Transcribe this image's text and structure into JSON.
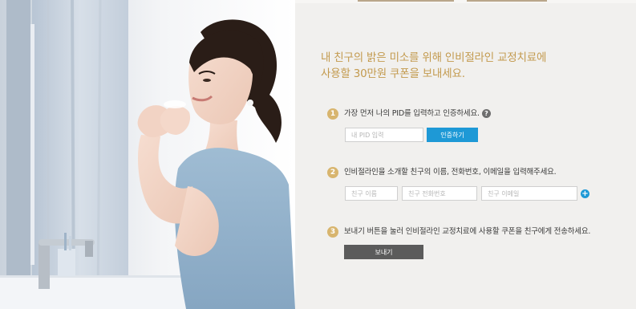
{
  "headline": {
    "line1": "내 친구의 밝은 미소를 위해 인비절라인 교정치료에",
    "line2": "사용할 30만원 쿠폰을 보내세요."
  },
  "steps": [
    {
      "number": "1",
      "text": "가장 먼저 나의 PID를 입력하고 인증하세요.",
      "help": "?"
    },
    {
      "number": "2",
      "text": "인비절라인을 소개할 친구의 이름, 전화번호, 이메일을 입력해주세요."
    },
    {
      "number": "3",
      "text": "보내기 버튼을 눌러 인비절라인 교정치료에 사용할 쿠폰을 친구에게 전송하세요."
    }
  ],
  "form": {
    "pid_placeholder": "내 PID 입력",
    "verify_label": "인증하기",
    "friend_name_placeholder": "친구 이름",
    "friend_phone_placeholder": "친구 전화번호",
    "friend_email_placeholder": "친구 이메일",
    "add_label": "+",
    "send_label": "보내기"
  },
  "colors": {
    "headline": "#c39a4e",
    "badge": "#d8b56e",
    "primary_button": "#1e99d6",
    "send_button": "#5b5b5b",
    "panel_background": "#f1f0ee"
  },
  "photo": {
    "icon": "woman-with-aligner-photo"
  }
}
